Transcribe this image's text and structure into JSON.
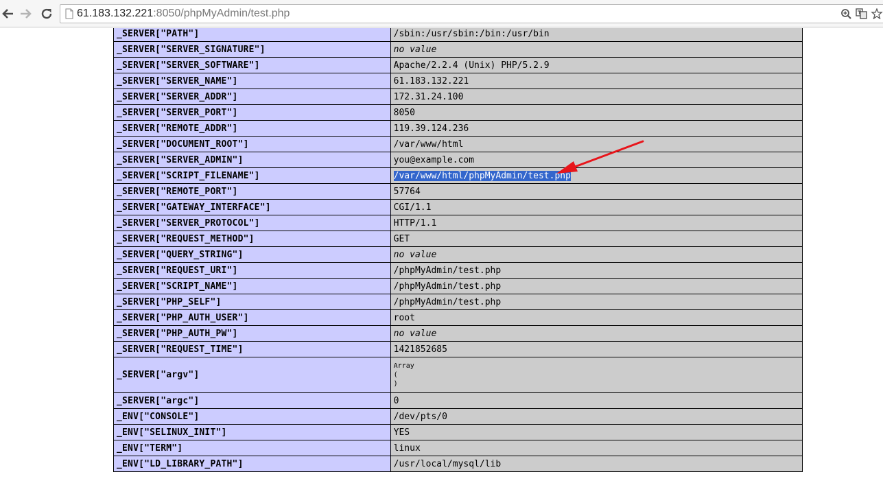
{
  "browser": {
    "url_host": "61.183.132.221",
    "url_rest": ":8050/phpMyAdmin/test.php"
  },
  "rows": [
    {
      "key": "_SERVER[\"PATH\"]",
      "value": "/sbin:/usr/sbin:/bin:/usr/bin"
    },
    {
      "key": "_SERVER[\"SERVER_SIGNATURE\"]",
      "value": "no value",
      "novalue": true
    },
    {
      "key": "_SERVER[\"SERVER_SOFTWARE\"]",
      "value": "Apache/2.2.4 (Unix) PHP/5.2.9"
    },
    {
      "key": "_SERVER[\"SERVER_NAME\"]",
      "value": "61.183.132.221"
    },
    {
      "key": "_SERVER[\"SERVER_ADDR\"]",
      "value": "172.31.24.100"
    },
    {
      "key": "_SERVER[\"SERVER_PORT\"]",
      "value": "8050"
    },
    {
      "key": "_SERVER[\"REMOTE_ADDR\"]",
      "value": "119.39.124.236"
    },
    {
      "key": "_SERVER[\"DOCUMENT_ROOT\"]",
      "value": "/var/www/html"
    },
    {
      "key": "_SERVER[\"SERVER_ADMIN\"]",
      "value": "you@example.com"
    },
    {
      "key": "_SERVER[\"SCRIPT_FILENAME\"]",
      "value": "/var/www/html/phpMyAdmin/test.php",
      "selected": true
    },
    {
      "key": "_SERVER[\"REMOTE_PORT\"]",
      "value": "57764"
    },
    {
      "key": "_SERVER[\"GATEWAY_INTERFACE\"]",
      "value": "CGI/1.1"
    },
    {
      "key": "_SERVER[\"SERVER_PROTOCOL\"]",
      "value": "HTTP/1.1"
    },
    {
      "key": "_SERVER[\"REQUEST_METHOD\"]",
      "value": "GET"
    },
    {
      "key": "_SERVER[\"QUERY_STRING\"]",
      "value": "no value",
      "novalue": true
    },
    {
      "key": "_SERVER[\"REQUEST_URI\"]",
      "value": "/phpMyAdmin/test.php"
    },
    {
      "key": "_SERVER[\"SCRIPT_NAME\"]",
      "value": "/phpMyAdmin/test.php"
    },
    {
      "key": "_SERVER[\"PHP_SELF\"]",
      "value": "/phpMyAdmin/test.php"
    },
    {
      "key": "_SERVER[\"PHP_AUTH_USER\"]",
      "value": "root"
    },
    {
      "key": "_SERVER[\"PHP_AUTH_PW\"]",
      "value": "no value",
      "novalue": true
    },
    {
      "key": "_SERVER[\"REQUEST_TIME\"]",
      "value": "1421852685"
    },
    {
      "key": "_SERVER[\"argv\"]",
      "value": "Array\n(\n)",
      "pre": true
    },
    {
      "key": "_SERVER[\"argc\"]",
      "value": "0"
    },
    {
      "key": "_ENV[\"CONSOLE\"]",
      "value": "/dev/pts/0"
    },
    {
      "key": "_ENV[\"SELINUX_INIT\"]",
      "value": "YES"
    },
    {
      "key": "_ENV[\"TERM\"]",
      "value": "linux"
    },
    {
      "key": "_ENV[\"LD_LIBRARY_PATH\"]",
      "value": "/usr/local/mysql/lib"
    }
  ],
  "colors": {
    "key_cell_bg": "#ccccff",
    "value_cell_bg": "#cccccc",
    "selection_bg": "#3366cc",
    "annotation_arrow": "#e8151b"
  }
}
